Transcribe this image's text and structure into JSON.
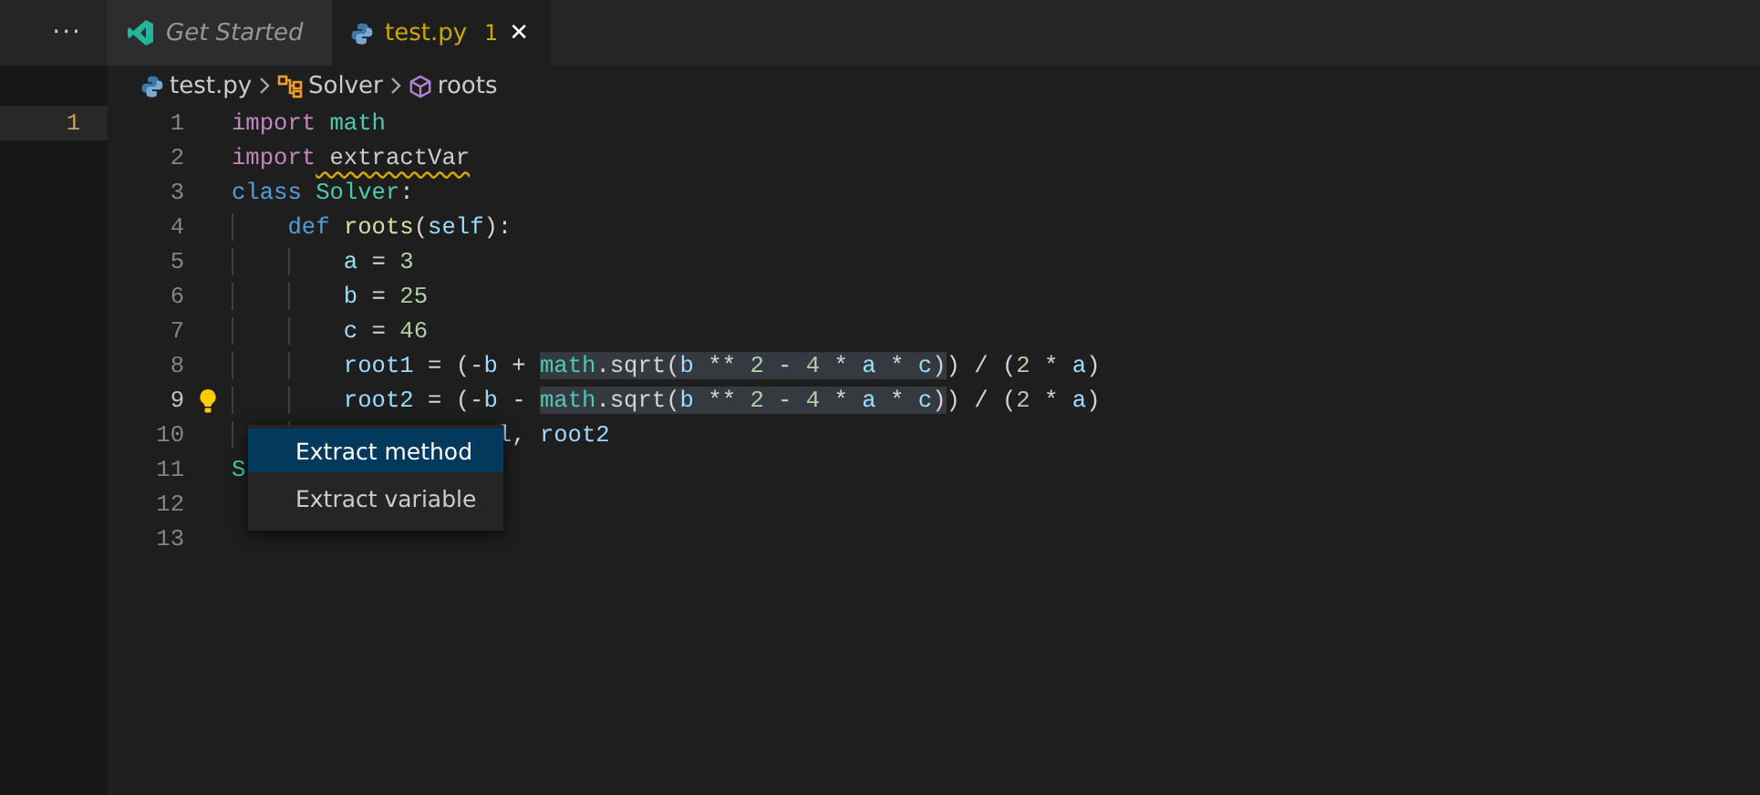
{
  "left_pane": {
    "line_number": "1"
  },
  "tabs_more": "···",
  "tabs": [
    {
      "label": "Get Started",
      "kind": "welcome",
      "selected": false
    },
    {
      "label": "test.py",
      "kind": "python",
      "selected": true,
      "problems": "1",
      "close": "✕"
    }
  ],
  "breadcrumbs": [
    {
      "label": "test.py",
      "kind": "file"
    },
    {
      "label": "Solver",
      "kind": "class"
    },
    {
      "label": "roots",
      "kind": "method"
    }
  ],
  "lines": [
    {
      "number": "1",
      "current": false,
      "tokens": [
        {
          "text": "import",
          "kind": "import"
        },
        {
          "text": " math",
          "kind": "module"
        }
      ]
    },
    {
      "number": "2",
      "current": false,
      "tokens": [
        {
          "text": "import",
          "kind": "import"
        },
        {
          "text": " extractVar",
          "kind": "unresolved",
          "squiggle": true
        }
      ]
    },
    {
      "number": "3",
      "current": false,
      "tokens": [
        {
          "text": "class",
          "kind": "keyword"
        },
        {
          "text": " Solver",
          "kind": "type"
        },
        {
          "text": ":",
          "kind": "plain"
        }
      ]
    },
    {
      "number": "4",
      "current": false,
      "tokens": [
        {
          "text": "    def",
          "kind": "keyword"
        },
        {
          "text": " roots",
          "kind": "function"
        },
        {
          "text": "(",
          "kind": "plain"
        },
        {
          "text": "self",
          "kind": "variable"
        },
        {
          "text": "):",
          "kind": "plain"
        }
      ]
    },
    {
      "number": "5",
      "current": false,
      "tokens": [
        {
          "text": "        a",
          "kind": "variable"
        },
        {
          "text": " = ",
          "kind": "plain"
        },
        {
          "text": "3",
          "kind": "number"
        }
      ]
    },
    {
      "number": "6",
      "current": false,
      "tokens": [
        {
          "text": "        b",
          "kind": "variable"
        },
        {
          "text": " = ",
          "kind": "plain"
        },
        {
          "text": "25",
          "kind": "number"
        }
      ]
    },
    {
      "number": "7",
      "current": false,
      "tokens": [
        {
          "text": "        c",
          "kind": "variable"
        },
        {
          "text": " = ",
          "kind": "plain"
        },
        {
          "text": "46",
          "kind": "number"
        }
      ]
    },
    {
      "number": "8",
      "current": false,
      "tokens": [
        {
          "text": "        root1",
          "kind": "variable"
        },
        {
          "text": " = (-",
          "kind": "plain"
        },
        {
          "text": "b",
          "kind": "variable"
        },
        {
          "text": " + ",
          "kind": "plain"
        },
        {
          "text": "math",
          "kind": "module",
          "highlighted": true
        },
        {
          "text": ".sqrt(",
          "kind": "plain",
          "highlighted": true
        },
        {
          "text": "b",
          "kind": "variable",
          "highlighted": true
        },
        {
          "text": " ** ",
          "kind": "plain",
          "highlighted": true
        },
        {
          "text": "2",
          "kind": "number",
          "highlighted": true
        },
        {
          "text": " - ",
          "kind": "plain",
          "highlighted": true
        },
        {
          "text": "4",
          "kind": "number",
          "highlighted": true
        },
        {
          "text": " * ",
          "kind": "plain",
          "highlighted": true
        },
        {
          "text": "a",
          "kind": "variable",
          "highlighted": true
        },
        {
          "text": " * ",
          "kind": "plain",
          "highlighted": true
        },
        {
          "text": "c",
          "kind": "variable",
          "highlighted": true
        },
        {
          "text": ")",
          "kind": "plain",
          "highlighted": true
        },
        {
          "text": ") / (",
          "kind": "plain"
        },
        {
          "text": "2",
          "kind": "number"
        },
        {
          "text": " * ",
          "kind": "plain"
        },
        {
          "text": "a",
          "kind": "variable"
        },
        {
          "text": ")",
          "kind": "plain"
        }
      ]
    },
    {
      "number": "9",
      "current": true,
      "lightbulb": true,
      "tokens": [
        {
          "text": "        root2",
          "kind": "variable"
        },
        {
          "text": " = (-",
          "kind": "plain"
        },
        {
          "text": "b",
          "kind": "variable"
        },
        {
          "text": " - ",
          "kind": "plain"
        },
        {
          "text": "math",
          "kind": "module",
          "highlighted": true
        },
        {
          "text": ".sqrt(",
          "kind": "plain",
          "highlighted": true
        },
        {
          "text": "b",
          "kind": "variable",
          "highlighted": true
        },
        {
          "text": " ** ",
          "kind": "plain",
          "highlighted": true
        },
        {
          "text": "2",
          "kind": "number",
          "highlighted": true
        },
        {
          "text": " - ",
          "kind": "plain",
          "highlighted": true
        },
        {
          "text": "4",
          "kind": "number",
          "highlighted": true
        },
        {
          "text": " * ",
          "kind": "plain",
          "highlighted": true
        },
        {
          "text": "a",
          "kind": "variable",
          "highlighted": true
        },
        {
          "text": " * ",
          "kind": "plain",
          "highlighted": true
        },
        {
          "text": "c",
          "kind": "variable",
          "highlighted": true
        },
        {
          "text": ")",
          "kind": "plain",
          "highlighted": true
        },
        {
          "text": ") / (",
          "kind": "plain"
        },
        {
          "text": "2",
          "kind": "number"
        },
        {
          "text": " * ",
          "kind": "plain"
        },
        {
          "text": "a",
          "kind": "variable"
        },
        {
          "text": ")",
          "kind": "plain"
        }
      ]
    },
    {
      "number": "10",
      "current": false,
      "tokens": [
        {
          "text": "                   l",
          "kind": "variable"
        },
        {
          "text": ", ",
          "kind": "plain"
        },
        {
          "text": "root2",
          "kind": "variable"
        }
      ]
    },
    {
      "number": "11",
      "current": false,
      "tokens": [
        {
          "text": "S",
          "kind": "type"
        }
      ]
    },
    {
      "number": "12",
      "current": false
    },
    {
      "number": "13",
      "current": false
    }
  ],
  "context_menu": [
    {
      "label": "Extract method",
      "selected": true
    },
    {
      "label": "Extract variable",
      "selected": false
    }
  ]
}
